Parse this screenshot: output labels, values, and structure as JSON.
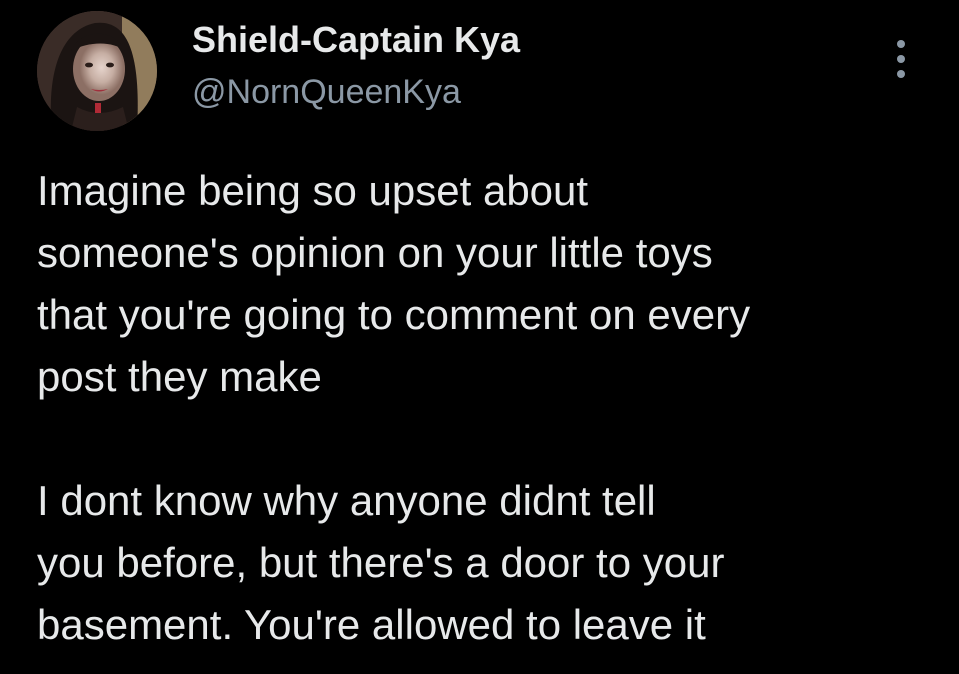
{
  "author": {
    "display_name": "Shield-Captain Kya",
    "handle": "@NornQueenKya",
    "avatar_icon": "profile-photo-icon"
  },
  "menu": {
    "more_icon": "more-options-icon"
  },
  "tweet": {
    "paragraph1": [
      "Imagine being so upset about",
      "someone's opinion on your little toys",
      "that you're going to comment on every",
      "post they make"
    ],
    "paragraph2": [
      "I dont know why anyone didnt tell",
      "you before, but there's a door to your",
      "basement. You're allowed to leave it"
    ]
  },
  "colors": {
    "background": "#000000",
    "primary_text": "#e7e9ea",
    "secondary_text": "#8b98a5"
  }
}
